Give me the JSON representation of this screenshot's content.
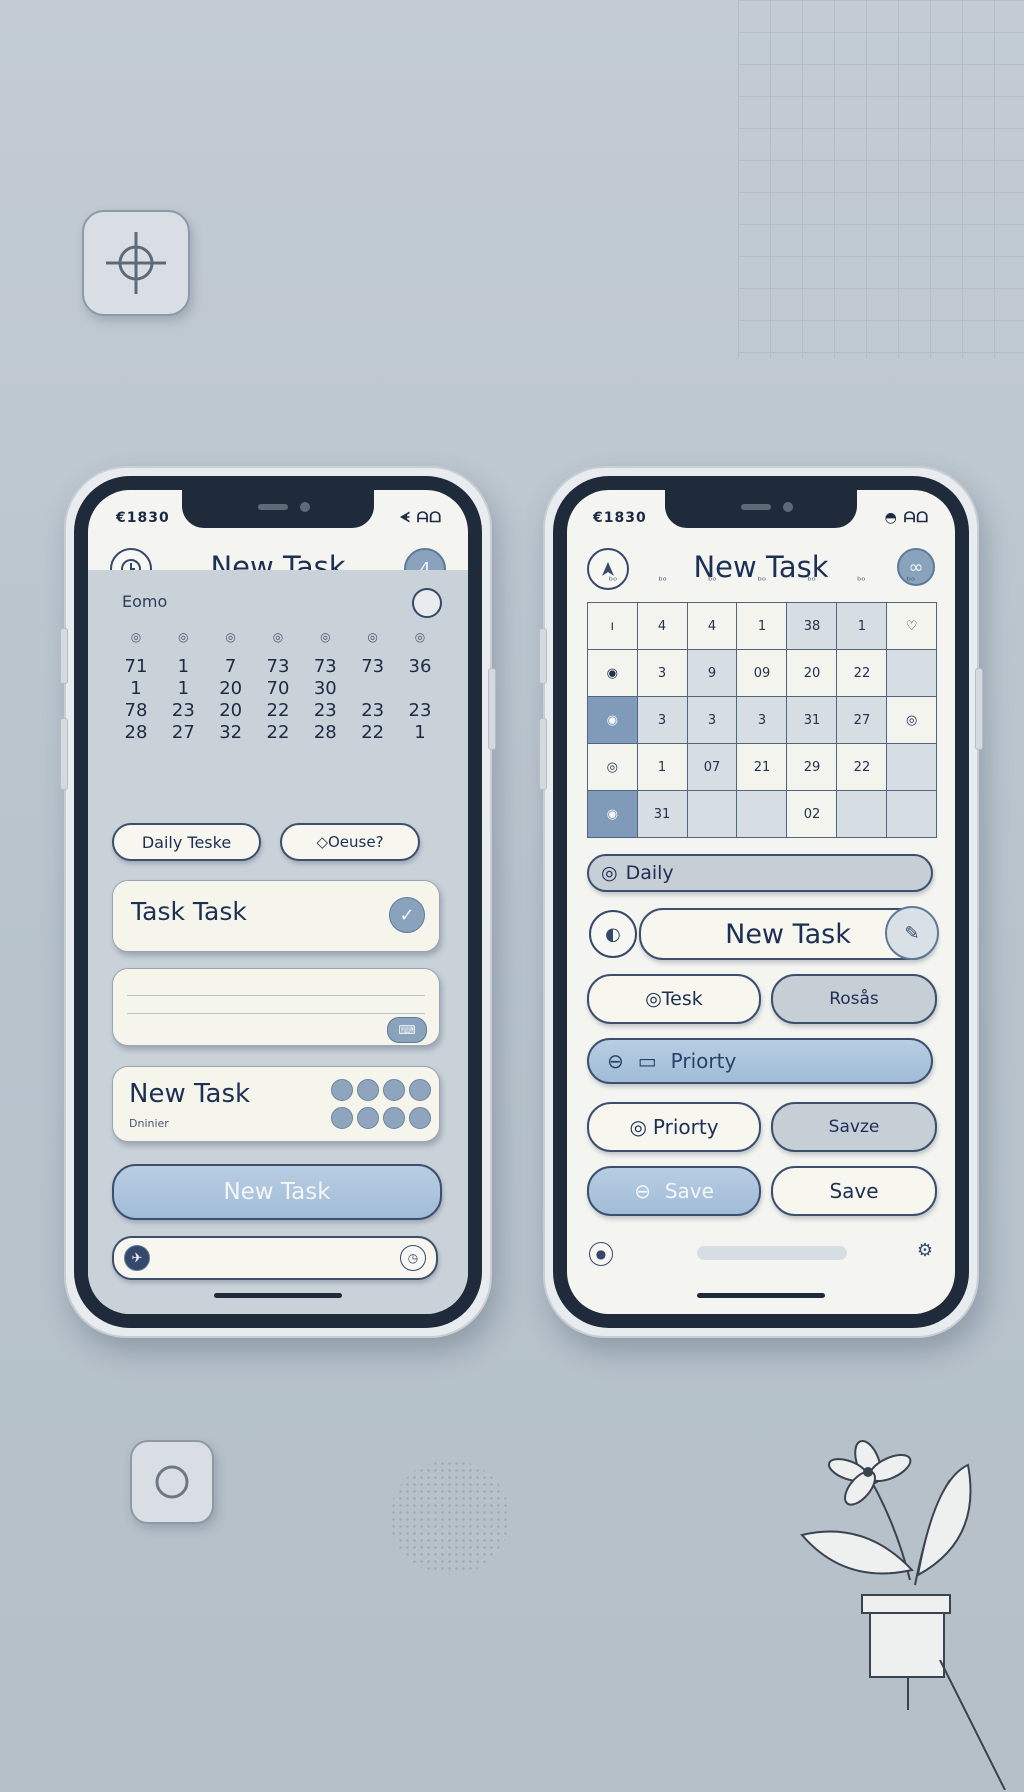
{
  "colors": {
    "background": "#bfc8d0",
    "ink": "#1c2f55",
    "accent_blue": "#a1bcd8",
    "card": "#f6f5ec"
  },
  "left_phone": {
    "status": {
      "time": "€1830",
      "icons": "ᗛ ᗩᗝ"
    },
    "header": {
      "title": "New Task",
      "left_icon": "clock-icon",
      "right_icon": "calendar-icon",
      "right_glyph": "4"
    },
    "calendar": {
      "label": "Eomo",
      "weekdays": [
        "◎",
        "◎",
        "◎",
        "◎",
        "◎",
        "◎",
        "◎"
      ],
      "rows": [
        [
          "71",
          "1",
          "7",
          "73",
          "73",
          "73",
          "36"
        ],
        [
          "1",
          "1",
          "20",
          "70",
          "30",
          "",
          ""
        ],
        [
          "78",
          "23",
          "20",
          "22",
          "23",
          "23",
          "23"
        ],
        [
          "28",
          "27",
          "32",
          "22",
          "28",
          "22",
          "1"
        ]
      ]
    },
    "chips": {
      "left": "Daily Teske",
      "right": "◇Oeuse?"
    },
    "task_card": {
      "title": "Task Task",
      "check_icon": "check-circle-icon"
    },
    "note_card": {
      "placeholder": "",
      "action_icon": "keyboard-icon"
    },
    "new_task_card": {
      "title": "New Task",
      "subtitle": "Dninier"
    },
    "primary_button": {
      "label": "New Task"
    },
    "bottom_bar": {
      "left_icon": "airplane-icon",
      "right_icon": "clock-icon"
    }
  },
  "right_phone": {
    "status": {
      "time": "€1830",
      "icons": "◓ ᗩᗝ"
    },
    "header": {
      "title": "New Task",
      "left_icon": "navigation-icon",
      "right_icon": "link-icon"
    },
    "calendar": {
      "weekdays": [
        "ᵇᵒ",
        "ᵇᵒ",
        "ᵇᵒ",
        "ᵇᵒ",
        "ᵇᵒ",
        "ᵇᵒ",
        "ᵇᵒ"
      ],
      "rows": [
        [
          "ı",
          "4",
          "4",
          "1",
          "38",
          "1",
          "♡"
        ],
        [
          "◉",
          "3",
          "9",
          "09",
          "20",
          "22",
          ""
        ],
        [
          "◉",
          "3",
          "3",
          "3",
          "31",
          "27",
          "◎"
        ],
        [
          "◎",
          "1",
          "07",
          "21",
          "29",
          "22",
          ""
        ],
        [
          "◉",
          "31",
          "",
          "",
          "02",
          "",
          ""
        ]
      ]
    },
    "daily_bar": {
      "label": "Daily"
    },
    "new_task_pill": {
      "label": "New Task"
    },
    "task_chip": {
      "label": "◎Tesk"
    },
    "roses_chip": {
      "label": "Rosås"
    },
    "priority_bar": {
      "label": "Priorty"
    },
    "priority_chip": {
      "label": "Priorty"
    },
    "save_outline_chip": {
      "label": "Savze"
    },
    "save_blue": {
      "label": "Save"
    },
    "save_white": {
      "label": "Save"
    },
    "bottom_bar": {
      "left_icon": "record-icon",
      "right_icon": "settings-icon"
    }
  }
}
